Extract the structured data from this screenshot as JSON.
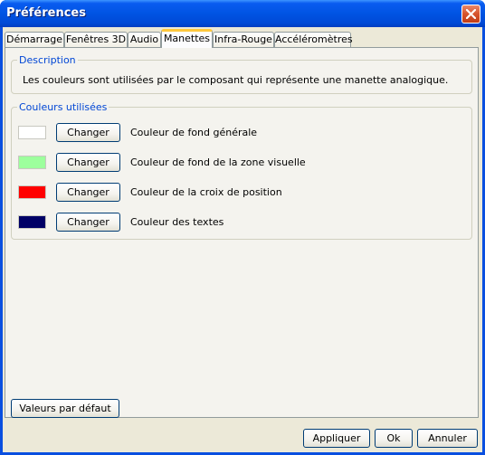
{
  "window": {
    "title": "Préférences"
  },
  "tabs": [
    {
      "label": "Démarrage"
    },
    {
      "label": "Fenêtres 3D"
    },
    {
      "label": "Audio"
    },
    {
      "label": "Manettes"
    },
    {
      "label": "Infra-Rouge"
    },
    {
      "label": "Accéléromètres"
    }
  ],
  "active_tab": "Manettes",
  "description": {
    "title": "Description",
    "text": "Les couleurs sont utilisées par le composant qui représente une manette analogique."
  },
  "colors_group": {
    "title": "Couleurs utilisées",
    "items": [
      {
        "color": "#ffffff",
        "button": "Changer",
        "label": "Couleur de fond générale"
      },
      {
        "color": "#9dff9d",
        "button": "Changer",
        "label": "Couleur de fond de la zone visuelle"
      },
      {
        "color": "#ff0000",
        "button": "Changer",
        "label": "Couleur de la croix de position"
      },
      {
        "color": "#000066",
        "button": "Changer",
        "label": "Couleur des textes"
      }
    ]
  },
  "defaults_button": "Valeurs par défaut",
  "footer": {
    "apply": "Appliquer",
    "ok": "Ok",
    "cancel": "Annuler"
  }
}
